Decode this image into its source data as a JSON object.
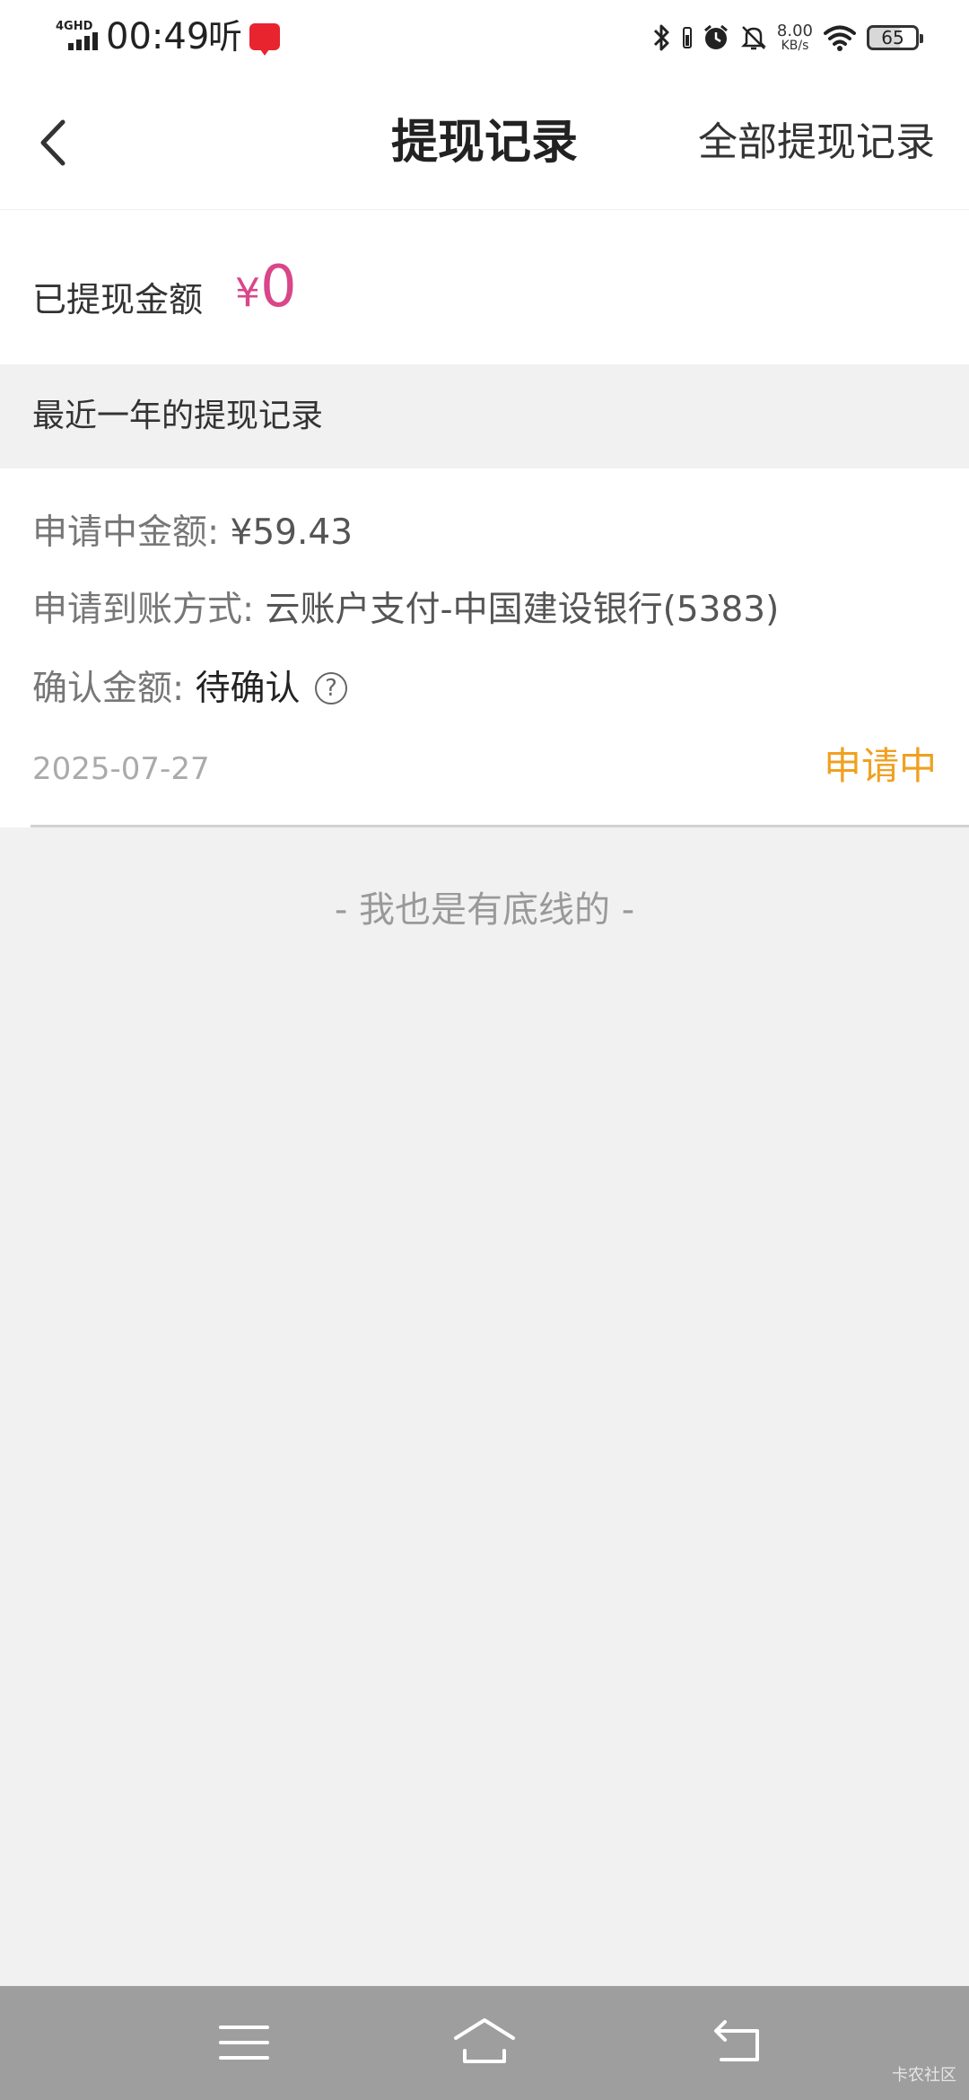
{
  "status_bar": {
    "network_type": "4GHD",
    "time": "00:49",
    "ting_label": "听",
    "net_speed": "8.00",
    "net_speed_unit": "KB/s",
    "battery": "65"
  },
  "header": {
    "title": "提现记录",
    "right_action": "全部提现记录"
  },
  "summary": {
    "label": "已提现金额",
    "currency": "¥",
    "amount": "0"
  },
  "section": {
    "title": "最近一年的提现记录"
  },
  "record": {
    "applying_amount_label": "申请中金额:",
    "applying_amount_value": "¥59.43",
    "method_label": "申请到账方式:",
    "method_value": "云账户支付-中国建设银行(5383)",
    "confirm_amount_label": "确认金额:",
    "confirm_amount_value": "待确认",
    "help_icon_glyph": "?",
    "date": "2025-07-27",
    "status": "申请中"
  },
  "footer": {
    "bottom_line_text": "- 我也是有底线的 -",
    "watermark": "卡农社区"
  },
  "colors": {
    "accent_pink": "#d9468a",
    "status_orange": "#f0a020",
    "background": "#f1f1f1",
    "nav_bar": "#9e9e9e"
  },
  "icons": {
    "back": "chevron-left-icon",
    "help": "question-circle-icon",
    "nav_menu": "menu-icon",
    "nav_home": "home-icon",
    "nav_back": "return-icon"
  }
}
